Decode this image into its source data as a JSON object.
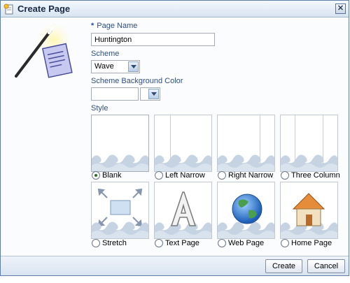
{
  "dialog": {
    "title": "Create Page",
    "close_glyph": "✕"
  },
  "form": {
    "required_marker": "*",
    "page_name_label": "Page Name",
    "page_name_value": "Huntington",
    "scheme_label": "Scheme",
    "scheme_value": "Wave",
    "bg_color_label": "Scheme Background Color",
    "bg_color_value": "",
    "style_label": "Style"
  },
  "styles": [
    {
      "label": "Blank",
      "selected": true,
      "icon": "blank-layout-icon"
    },
    {
      "label": "Left Narrow",
      "selected": false,
      "icon": "left-narrow-layout-icon"
    },
    {
      "label": "Right Narrow",
      "selected": false,
      "icon": "right-narrow-layout-icon"
    },
    {
      "label": "Three Column",
      "selected": false,
      "icon": "three-column-layout-icon"
    },
    {
      "label": "Stretch",
      "selected": false,
      "icon": "stretch-arrows-icon"
    },
    {
      "label": "Text Page",
      "selected": false,
      "icon": "letter-a-icon"
    },
    {
      "label": "Web Page",
      "selected": false,
      "icon": "globe-icon"
    },
    {
      "label": "Home Page",
      "selected": false,
      "icon": "house-icon"
    }
  ],
  "buttons": {
    "create": "Create",
    "cancel": "Cancel"
  },
  "colors": {
    "accent": "#2f4f7f",
    "wave": "#c5d3e3",
    "titlebar": "#d8e4f1"
  }
}
